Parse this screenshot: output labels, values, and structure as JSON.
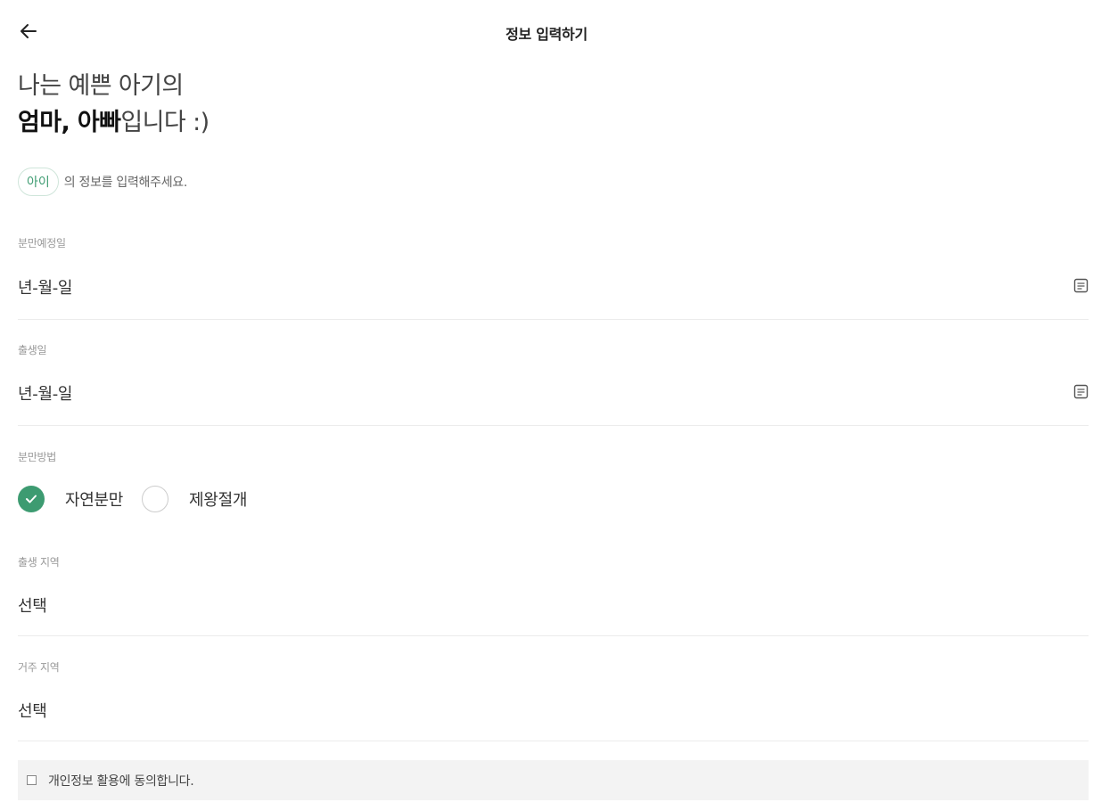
{
  "header": {
    "title": "정보 입력하기",
    "back_icon": "arrow-left-icon"
  },
  "intro": {
    "line1": "나는 예쁜 아기의",
    "line2_bold": "엄마, 아빠",
    "line2_rest": "입니다 :)"
  },
  "child": {
    "chip": "아이",
    "desc": "의 정보를 입력해주세요."
  },
  "fields": {
    "due_date": {
      "label": "분만예정일",
      "value": "년-월-일",
      "icon": "calendar-icon"
    },
    "birth_date": {
      "label": "출생일",
      "value": "년-월-일",
      "icon": "calendar-icon"
    },
    "delivery_method": {
      "label": "분만방법",
      "options": [
        "자연분만",
        "제왕절개"
      ],
      "selected": "자연분만"
    },
    "birth_region": {
      "label": "출생 지역",
      "value": "선택"
    },
    "residence_region": {
      "label": "거주 지역",
      "value": "선택"
    }
  },
  "agreement": {
    "label": "개인정보 활용에 동의합니다.",
    "checked": false
  },
  "colors": {
    "accent": "#3d9b71",
    "divider": "#ececec",
    "agree_bg": "#f3f3f3"
  }
}
